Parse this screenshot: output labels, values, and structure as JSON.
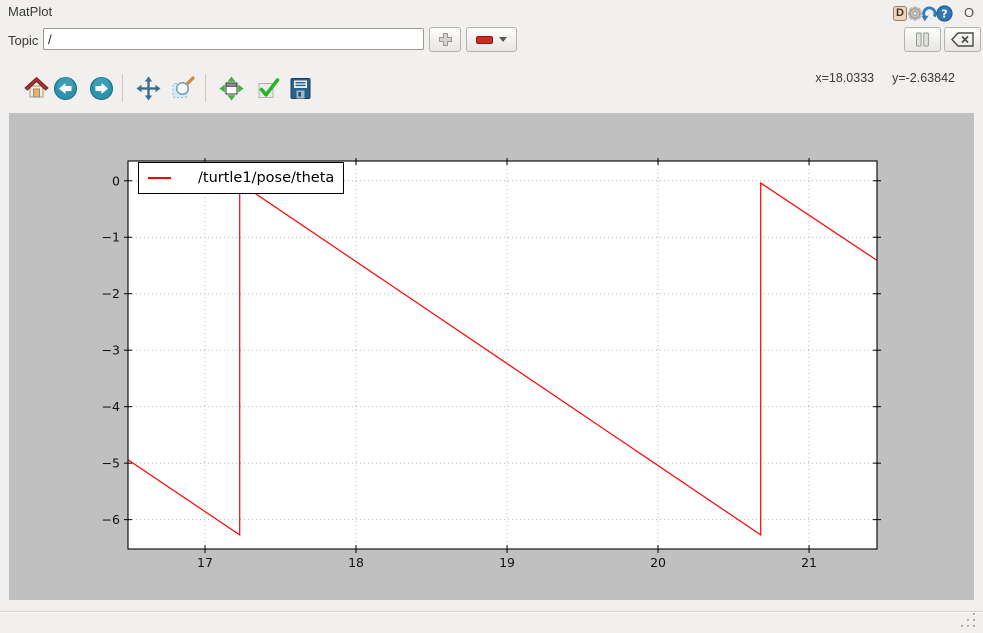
{
  "window": {
    "title": "MatPlot"
  },
  "titlebar": {
    "dock_letter": "D",
    "help_glyph": "?",
    "o_label": "O",
    "icons": [
      "dock-d",
      "settings-gear",
      "reload",
      "help",
      "close-circle"
    ]
  },
  "topic_row": {
    "label": "Topic",
    "value": "/",
    "add_icon": "plus",
    "remove_icon": "minus-dropdown"
  },
  "controls": {
    "pause_icon": "pause",
    "clear_icon": "backspace-clear"
  },
  "nav_toolbar": {
    "icons": [
      "home",
      "back",
      "forward",
      "pan",
      "zoom-rect",
      "configure-subplots",
      "customize-check",
      "save"
    ],
    "coords": {
      "x": "x=18.0333",
      "y": "y=-2.63842"
    }
  },
  "chart_data": {
    "type": "line",
    "title": "",
    "xlabel": "",
    "ylabel": "",
    "xlim": [
      16.49,
      21.45
    ],
    "ylim": [
      -6.52,
      0.35
    ],
    "xticks": [
      17,
      18,
      19,
      20,
      21
    ],
    "yticks": [
      0,
      -1,
      -2,
      -3,
      -4,
      -5,
      -6
    ],
    "grid": true,
    "grid_color": "#b5b5b5",
    "figure_bg": "#c0c0c0",
    "plot_bg": "#ffffff",
    "legend": {
      "position": "upper-left",
      "entries": [
        "/turtle1/pose/theta"
      ]
    },
    "series": [
      {
        "name": "/turtle1/pose/theta",
        "color": "#ff0000",
        "points": [
          [
            16.49,
            -4.94
          ],
          [
            17.23,
            -6.27
          ],
          [
            17.23,
            -0.04
          ],
          [
            20.68,
            -6.27
          ],
          [
            20.68,
            -0.04
          ],
          [
            21.45,
            -1.41
          ]
        ]
      }
    ]
  }
}
